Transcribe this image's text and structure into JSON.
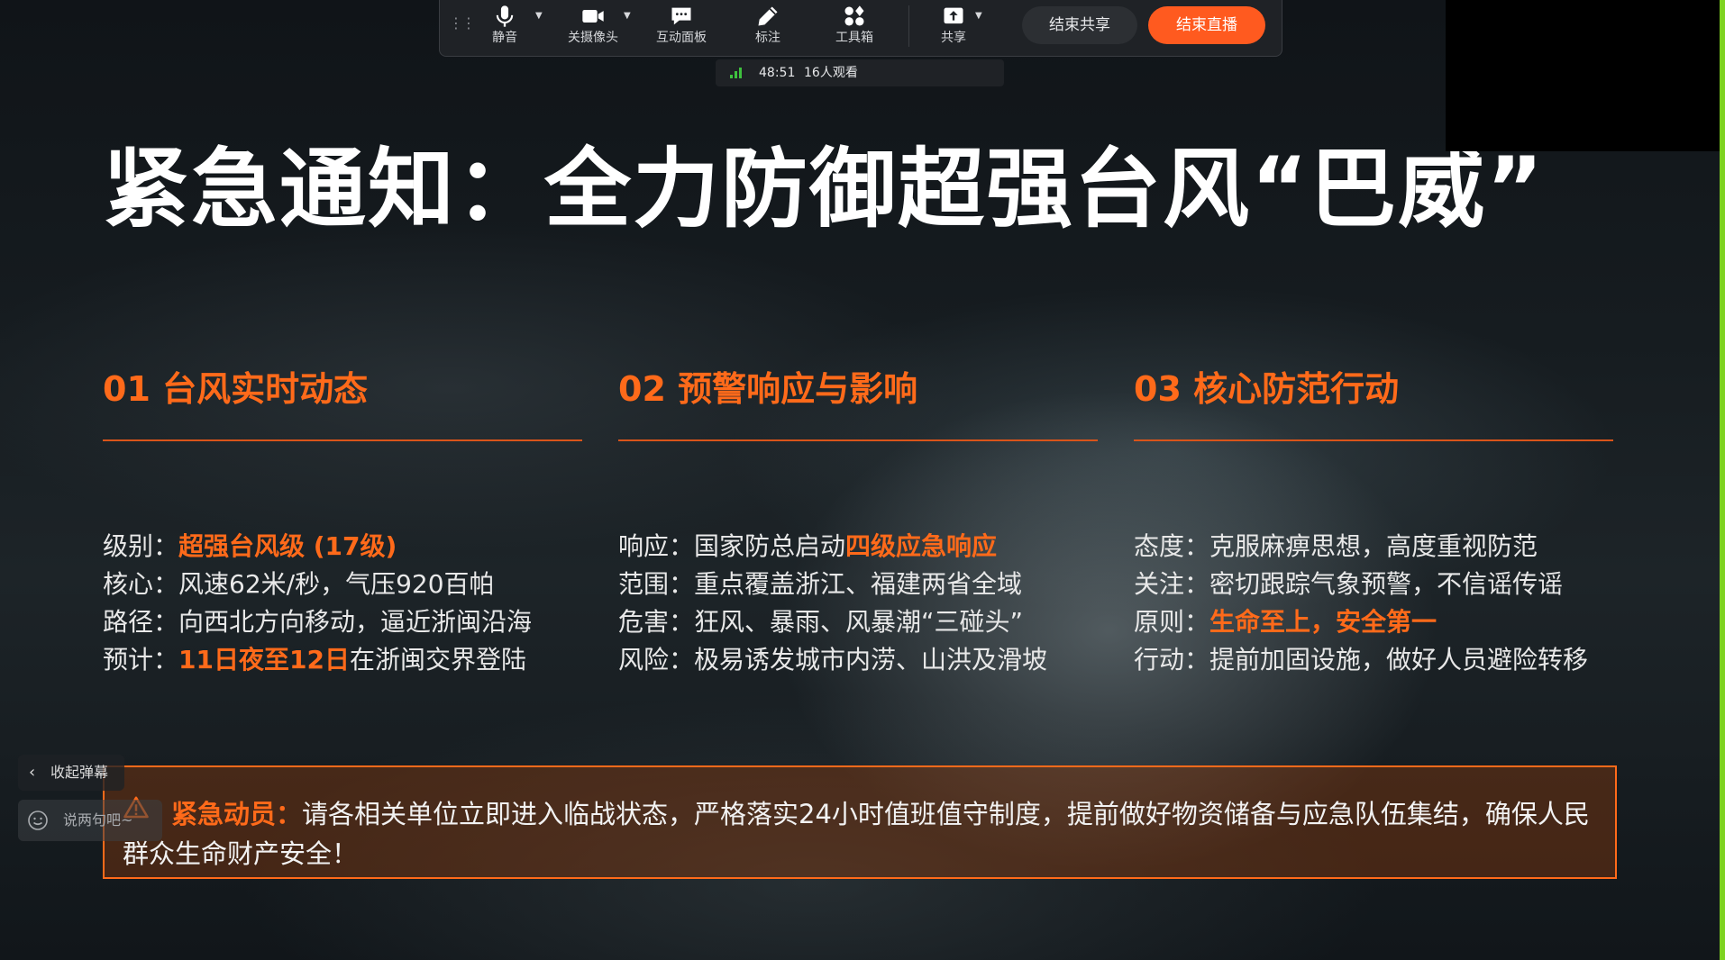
{
  "toolbar": {
    "items": [
      {
        "label": "静音",
        "icon": "microphone-icon"
      },
      {
        "label": "关摄像头",
        "icon": "camera-icon"
      },
      {
        "label": "互动面板",
        "icon": "chat-icon"
      },
      {
        "label": "标注",
        "icon": "pen-icon"
      },
      {
        "label": "工具箱",
        "icon": "toolbox-icon"
      },
      {
        "label": "共享",
        "icon": "share-icon"
      }
    ],
    "end_share": "结束共享",
    "end_live": "结束直播"
  },
  "status": {
    "time": "48:51",
    "viewers": "16人观看"
  },
  "slide": {
    "title": "紧急通知：全力防御超强台风“巴威”",
    "columns": [
      {
        "heading": "01 台风实时动态",
        "rows": [
          {
            "pre": "级别：",
            "hl": "超强台风级 (17级)",
            "post": ""
          },
          {
            "pre": "核心：风速62米/秒，气压920百帕",
            "hl": "",
            "post": ""
          },
          {
            "pre": "路径：向西北方向移动，逼近浙闽沿海",
            "hl": "",
            "post": ""
          },
          {
            "pre": "预计：",
            "hl": "11日夜至12日",
            "post": "在浙闽交界登陆"
          }
        ]
      },
      {
        "heading": "02 预警响应与影响",
        "rows": [
          {
            "pre": "响应：国家防总启动",
            "hl": "四级应急响应",
            "post": ""
          },
          {
            "pre": "范围：重点覆盖浙江、福建两省全域",
            "hl": "",
            "post": ""
          },
          {
            "pre": "危害：狂风、暴雨、风暴潮“三碰头”",
            "hl": "",
            "post": ""
          },
          {
            "pre": "风险：极易诱发城市内涝、山洪及滑坡",
            "hl": "",
            "post": ""
          }
        ]
      },
      {
        "heading": "03 核心防范行动",
        "rows": [
          {
            "pre": "态度：克服麻痹思想，高度重视防范",
            "hl": "",
            "post": ""
          },
          {
            "pre": "关注：密切跟踪气象预警，不信谣传谣",
            "hl": "",
            "post": ""
          },
          {
            "pre": "原则：",
            "hl": "生命至上，安全第一",
            "post": ""
          },
          {
            "pre": "行动：提前加固设施，做好人员避险转移",
            "hl": "",
            "post": ""
          }
        ]
      }
    ],
    "emergency": {
      "label": "紧急动员：",
      "text": "请各相关单位立即进入临战状态，严格落实24小时值班值守制度，提前做好物资储备与应急队伍集结，确保人民群众生命财产安全！"
    }
  },
  "danmaku": {
    "collapse": "收起弹幕",
    "placeholder": "说两句吧~"
  },
  "colors": {
    "accent": "#ff6a1a",
    "end_live": "#ff5a1f",
    "signal": "#3ec13e"
  }
}
